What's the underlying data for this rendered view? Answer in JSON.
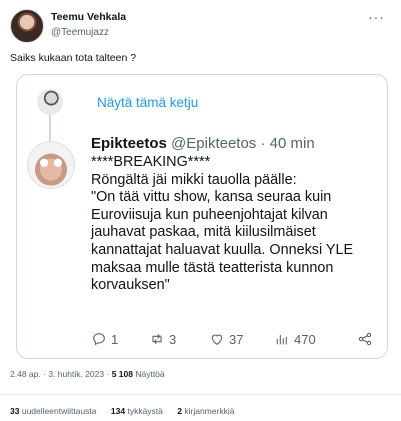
{
  "author": {
    "name": "Teemu Vehkala",
    "handle": "@Teemujazz"
  },
  "tweet": {
    "text": "Saiks kukaan tota talteen ?"
  },
  "quoted": {
    "show_thread_label": "Näytä tämä ketju",
    "name": "Epikteetos",
    "handle": "@Epikteetos",
    "separator": "·",
    "time": "40 min",
    "body": "****BREAKING****\nRöngältä jäi mikki tauolla päälle:\n\"On tää vittu show, kansa seuraa kuin Euroviisuja kun puheenjohtajat kilvan jauhavat paskaa, mitä kiilusilmäiset kannattajat haluavat kuulla. Onneksi YLE maksaa mulle tästä teatterista kunnon korvauksen\"",
    "actions": {
      "replies": "1",
      "retweets": "3",
      "likes": "37",
      "views": "470"
    },
    "icons": [
      "reply-icon",
      "retweet-icon",
      "like-icon",
      "views-icon",
      "share-icon"
    ]
  },
  "meta": {
    "time": "2.48 ap.",
    "dot": "·",
    "date": "3. huhtik. 2023",
    "views_count": "5 108",
    "views_label": "Näyttöä"
  },
  "stats": {
    "retweets_count": "33",
    "retweets_label": "uudelleentwiittausta",
    "likes_count": "134",
    "likes_label": "tykkäystä",
    "bookmarks_count": "2",
    "bookmarks_label": "kirjanmerkkiä"
  },
  "colors": {
    "accent": "#1d9bf0",
    "secondary_text": "#536471",
    "border": "#cfd9de"
  }
}
